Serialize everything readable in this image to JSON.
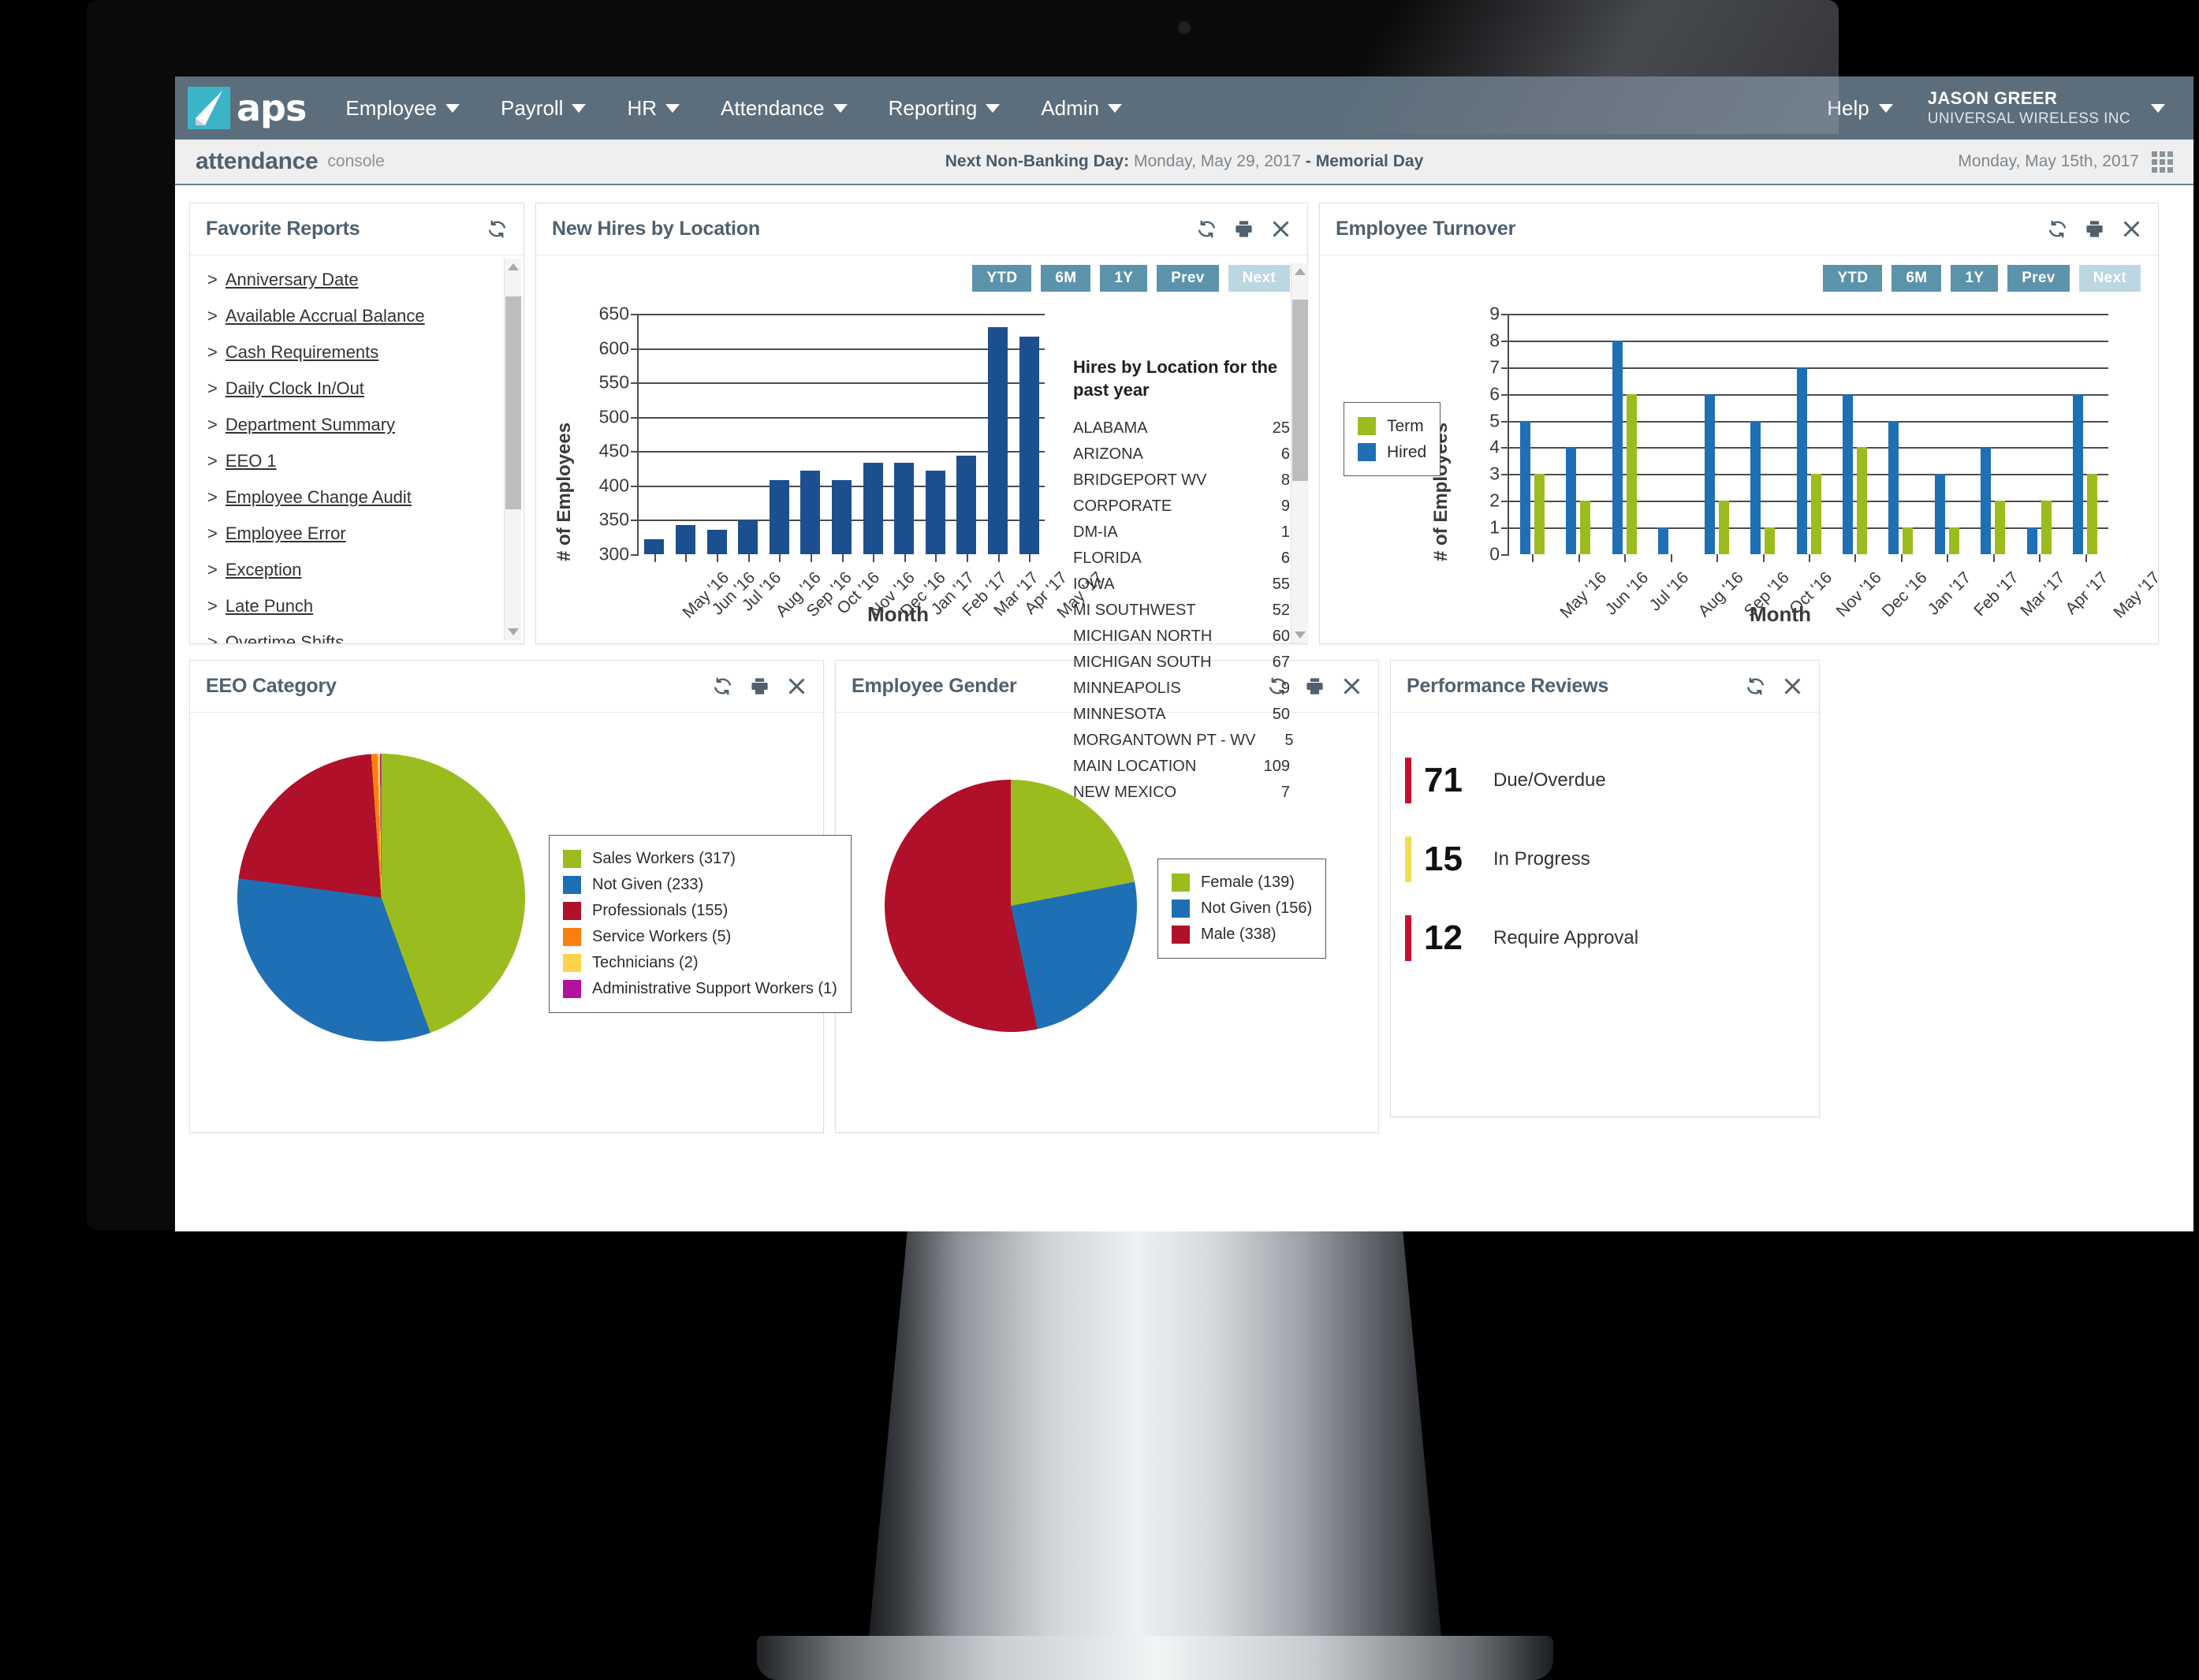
{
  "brand": {
    "name": "aps",
    "accent": "#3cb4c8",
    "navbar": "#5c6e7c"
  },
  "topnav": {
    "items": [
      {
        "label": "Employee"
      },
      {
        "label": "Payroll"
      },
      {
        "label": "HR"
      },
      {
        "label": "Attendance"
      },
      {
        "label": "Reporting"
      },
      {
        "label": "Admin"
      }
    ],
    "help_label": "Help",
    "user_name": "JASON GREER",
    "user_org": "UNIVERSAL WIRELESS INC"
  },
  "subheader": {
    "title": "attendance",
    "subtitle": "console",
    "banking_label": "Next Non-Banking Day:",
    "banking_date": "Monday, May 29, 2017",
    "banking_holiday": "- Memorial Day",
    "today": "Monday, May 15th, 2017"
  },
  "favorite_reports": {
    "title": "Favorite Reports",
    "items": [
      "Anniversary Date",
      "Available Accrual Balance",
      "Cash Requirements",
      "Daily Clock In/Out",
      "Department Summary",
      "EEO 1",
      "Employee Change Audit",
      "Employee Error",
      "Exception",
      "Late Punch",
      "Overtime Shifts"
    ],
    "bullet": ">"
  },
  "range_buttons": [
    {
      "label": "YTD",
      "disabled": false
    },
    {
      "label": "6M",
      "disabled": false
    },
    {
      "label": "1Y",
      "disabled": false
    },
    {
      "label": "Prev",
      "disabled": false
    },
    {
      "label": "Next",
      "disabled": true
    }
  ],
  "panels": {
    "hires": {
      "title": "New Hires by Location"
    },
    "turnover": {
      "title": "Employee Turnover"
    },
    "eeo": {
      "title": "EEO Category"
    },
    "gender": {
      "title": "Employee Gender"
    },
    "performance": {
      "title": "Performance Reviews"
    }
  },
  "hires_by_location": {
    "title": "Hires by Location for the past year",
    "rows": [
      {
        "name": "ALABAMA",
        "value": "25"
      },
      {
        "name": "ARIZONA",
        "value": "6"
      },
      {
        "name": "BRIDGEPORT WV",
        "value": "8"
      },
      {
        "name": "CORPORATE",
        "value": "9"
      },
      {
        "name": "DM-IA",
        "value": "1"
      },
      {
        "name": "FLORIDA",
        "value": "6"
      },
      {
        "name": "IOWA",
        "value": "55"
      },
      {
        "name": "MI SOUTHWEST",
        "value": "52"
      },
      {
        "name": "MICHIGAN NORTH",
        "value": "60"
      },
      {
        "name": "MICHIGAN SOUTH",
        "value": "67"
      },
      {
        "name": "MINNEAPOLIS",
        "value": "9"
      },
      {
        "name": "MINNESOTA",
        "value": "50"
      },
      {
        "name": "MORGANTOWN PT - WV",
        "value": "5"
      },
      {
        "name": "MAIN LOCATION",
        "value": "109"
      },
      {
        "name": "NEW MEXICO",
        "value": "7"
      }
    ]
  },
  "performance_reviews": {
    "rows": [
      {
        "count": "71",
        "label": "Due/Overdue",
        "color": "#c8102e"
      },
      {
        "count": "15",
        "label": "In Progress",
        "color": "#f5dd52"
      },
      {
        "count": "12",
        "label": "Require Approval",
        "color": "#c8102e"
      }
    ]
  },
  "chart_data": [
    {
      "id": "new_hires_by_location",
      "type": "bar",
      "title": "New Hires by Location",
      "xlabel": "Month",
      "ylabel": "# of Employees",
      "ylim": [
        300,
        650
      ],
      "yticks": [
        300,
        350,
        400,
        450,
        500,
        550,
        600,
        650
      ],
      "grid": true,
      "bar_color": "#1c4f8f",
      "categories": [
        "May '16",
        "Jun '16",
        "Jul '16",
        "Aug '16",
        "Sep '16",
        "Oct '16",
        "Nov '16",
        "Dec '16",
        "Jan '17",
        "Feb '17",
        "Mar '17",
        "Apr '17",
        "May '17"
      ],
      "values": [
        322,
        343,
        336,
        349,
        408,
        422,
        408,
        433,
        433,
        422,
        444,
        630,
        617
      ]
    },
    {
      "id": "employee_turnover",
      "type": "bar",
      "title": "Employee Turnover",
      "xlabel": "Month",
      "ylabel": "# of Employees",
      "ylim": [
        0,
        9
      ],
      "yticks": [
        0,
        1,
        2,
        3,
        4,
        5,
        6,
        7,
        8,
        9
      ],
      "grid": true,
      "legend_position": "left",
      "categories": [
        "May '16",
        "Jun '16",
        "Jul '16",
        "Aug '16",
        "Sep '16",
        "Oct '16",
        "Nov '16",
        "Dec '16",
        "Jan '17",
        "Feb '17",
        "Mar '17",
        "Apr '17",
        "May '17"
      ],
      "series": [
        {
          "name": "Hired",
          "color": "#1f6fb4",
          "values": [
            5,
            4,
            8,
            1,
            6,
            5,
            7,
            6,
            5,
            3,
            4,
            1,
            6
          ]
        },
        {
          "name": "Term",
          "color": "#9bbc1f",
          "values": [
            3,
            2,
            6,
            0,
            2,
            1,
            3,
            4,
            1,
            1,
            2,
            2,
            3
          ]
        }
      ]
    },
    {
      "id": "eeo_category",
      "type": "pie",
      "title": "EEO Category",
      "legend_position": "right",
      "slices": [
        {
          "label": "Sales Workers (317)",
          "value": 317,
          "color": "#9bbc1f"
        },
        {
          "label": "Not Given (233)",
          "value": 233,
          "color": "#1f6fb4"
        },
        {
          "label": "Professionals (155)",
          "value": 155,
          "color": "#b01029"
        },
        {
          "label": "Service Workers (5)",
          "value": 5,
          "color": "#f98010"
        },
        {
          "label": "Technicians (2)",
          "value": 2,
          "color": "#fcd34a"
        },
        {
          "label": "Administrative Support Workers (1)",
          "value": 1,
          "color": "#b3129e"
        }
      ]
    },
    {
      "id": "employee_gender",
      "type": "pie",
      "title": "Employee Gender",
      "legend_position": "right",
      "slices": [
        {
          "label": "Female (139)",
          "value": 139,
          "color": "#9bbc1f"
        },
        {
          "label": "Not Given (156)",
          "value": 156,
          "color": "#1f6fb4"
        },
        {
          "label": "Male (338)",
          "value": 338,
          "color": "#b01029"
        }
      ]
    }
  ]
}
